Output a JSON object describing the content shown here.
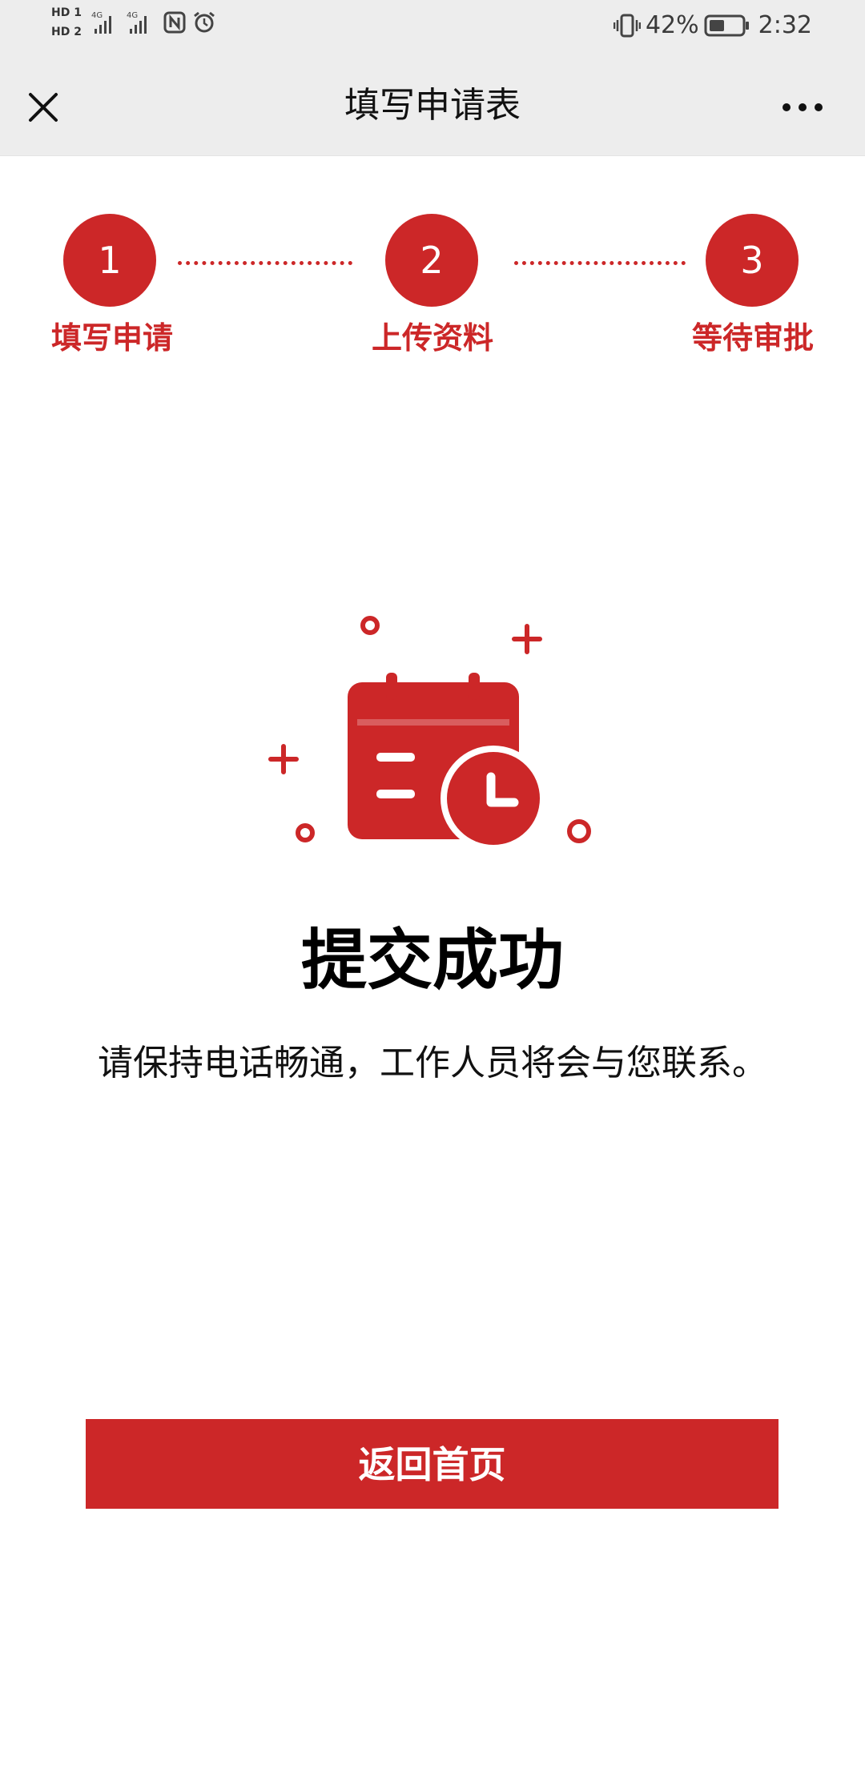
{
  "status_bar": {
    "sim1_label": "HD 1",
    "sim2_label": "HD 2",
    "network_label": "4G",
    "battery_percent": "42%",
    "time": "2:32",
    "icons": [
      "signal-icon",
      "nfc-icon",
      "alarm-icon",
      "vibrate-icon",
      "battery-icon"
    ]
  },
  "nav": {
    "title": "填写申请表",
    "close_icon": "close-icon",
    "more_icon": "more-icon"
  },
  "steps": [
    {
      "number": "1",
      "label": "填写申请"
    },
    {
      "number": "2",
      "label": "上传资料"
    },
    {
      "number": "3",
      "label": "等待审批"
    }
  ],
  "result": {
    "icon": "calendar-clock-icon",
    "title": "提交成功",
    "description": "请保持电话畅通，工作人员将会与您联系。"
  },
  "actions": {
    "home_button_label": "返回首页"
  },
  "colors": {
    "accent": "#cc2728",
    "bar_bg": "#ededed"
  }
}
